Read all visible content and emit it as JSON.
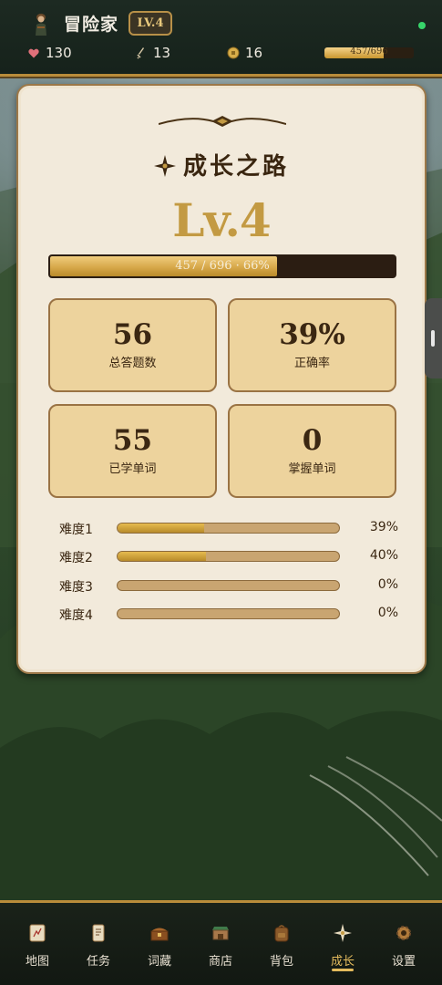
{
  "header": {
    "player_name": "冒险家",
    "level_badge": "LV.4",
    "hp": "130",
    "attack": "13",
    "coins": "16",
    "xp_text": "457/696",
    "xp_progress": 0.66,
    "online_color": "#37d56a"
  },
  "growth": {
    "title": "成长之路",
    "level": "Lv.4",
    "xp_text": "457 / 696 · 66%",
    "xp_progress": 0.66,
    "stats": [
      {
        "value": "56",
        "label": "总答题数"
      },
      {
        "value": "39%",
        "label": "正确率"
      },
      {
        "value": "55",
        "label": "已学单词"
      },
      {
        "value": "0",
        "label": "掌握单词"
      }
    ],
    "difficulties": [
      {
        "label": "难度1",
        "percent": "39%",
        "progress": 0.39
      },
      {
        "label": "难度2",
        "percent": "40%",
        "progress": 0.4
      },
      {
        "label": "难度3",
        "percent": "0%",
        "progress": 0
      },
      {
        "label": "难度4",
        "percent": "0%",
        "progress": 0
      }
    ]
  },
  "nav": {
    "items": [
      {
        "label": "地图",
        "icon": "map-icon"
      },
      {
        "label": "任务",
        "icon": "scroll-icon"
      },
      {
        "label": "词藏",
        "icon": "chest-icon"
      },
      {
        "label": "商店",
        "icon": "shop-icon"
      },
      {
        "label": "背包",
        "icon": "backpack-icon"
      },
      {
        "label": "成长",
        "icon": "star-icon",
        "active": true
      },
      {
        "label": "设置",
        "icon": "gear-icon"
      }
    ]
  },
  "colors": {
    "accent_gold": "#c39a43",
    "card_bg": "#f2eadb",
    "stat_box_bg": "#edd39d",
    "active_nav": "#e4bb5d"
  }
}
